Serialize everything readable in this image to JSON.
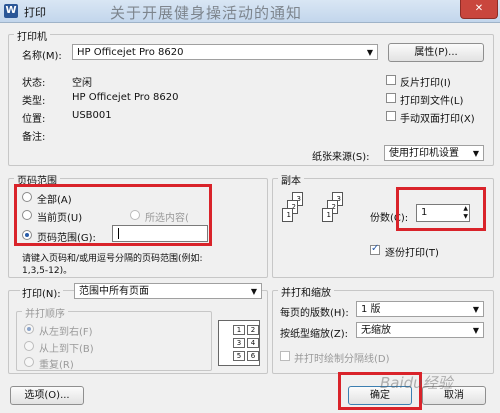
{
  "window": {
    "title": "打印",
    "app_icon": "W",
    "background_caption": "关于开展健身操活动的通知"
  },
  "printer": {
    "group_label": "打印机",
    "name_label": "名称(M):",
    "name_value": "HP Officejet Pro 8620",
    "properties_button": "属性(P)...",
    "status_label": "状态:",
    "status_value": "空闲",
    "type_label": "类型:",
    "type_value": "HP Officejet Pro 8620",
    "location_label": "位置:",
    "location_value": "USB001",
    "comment_label": "备注:",
    "options": [
      {
        "label": "反片打印(I)",
        "checked": false
      },
      {
        "label": "打印到文件(L)",
        "checked": false
      },
      {
        "label": "手动双面打印(X)",
        "checked": false
      }
    ],
    "paper_source_label": "纸张来源(S):",
    "paper_source_value": "使用打印机设置"
  },
  "page_range": {
    "group_label": "页码范围",
    "all": "全部(A)",
    "current": "当前页(U)",
    "selection": "所选内容(",
    "range": "页码范围(G):",
    "range_value": "",
    "hint_line1": "请键入页码和/或用逗号分隔的页码范围(例如:",
    "hint_line2": "1,3,5-12)。",
    "selected": "range"
  },
  "copies": {
    "group_label": "副本",
    "count_label": "份数(C):",
    "count_value": "1",
    "collate_label": "逐份打印(T)",
    "collate_checked": true
  },
  "print_what": {
    "label": "打印(N):",
    "value": "范围中所有页面",
    "order_group_label": "并打顺序",
    "order_ltr": "从左到右(F)",
    "order_ttb": "从上到下(B)",
    "order_repeat": "重复(R)",
    "order_cells": [
      "1",
      "2",
      "3",
      "4",
      "5",
      "6"
    ]
  },
  "zoom": {
    "group_label": "并打和缩放",
    "pages_per_sheet_label": "每页的版数(H):",
    "pages_per_sheet_value": "1 版",
    "scale_label": "按纸型缩放(Z):",
    "scale_value": "无缩放",
    "divider_label": "并打时绘制分隔线(D)"
  },
  "footer": {
    "options_button": "选项(O)...",
    "ok_button": "确定",
    "cancel_button": "取消"
  },
  "watermark": "Baidu经验",
  "colors": {
    "highlight": "#d9232a",
    "accent": "#2a5ca8"
  }
}
